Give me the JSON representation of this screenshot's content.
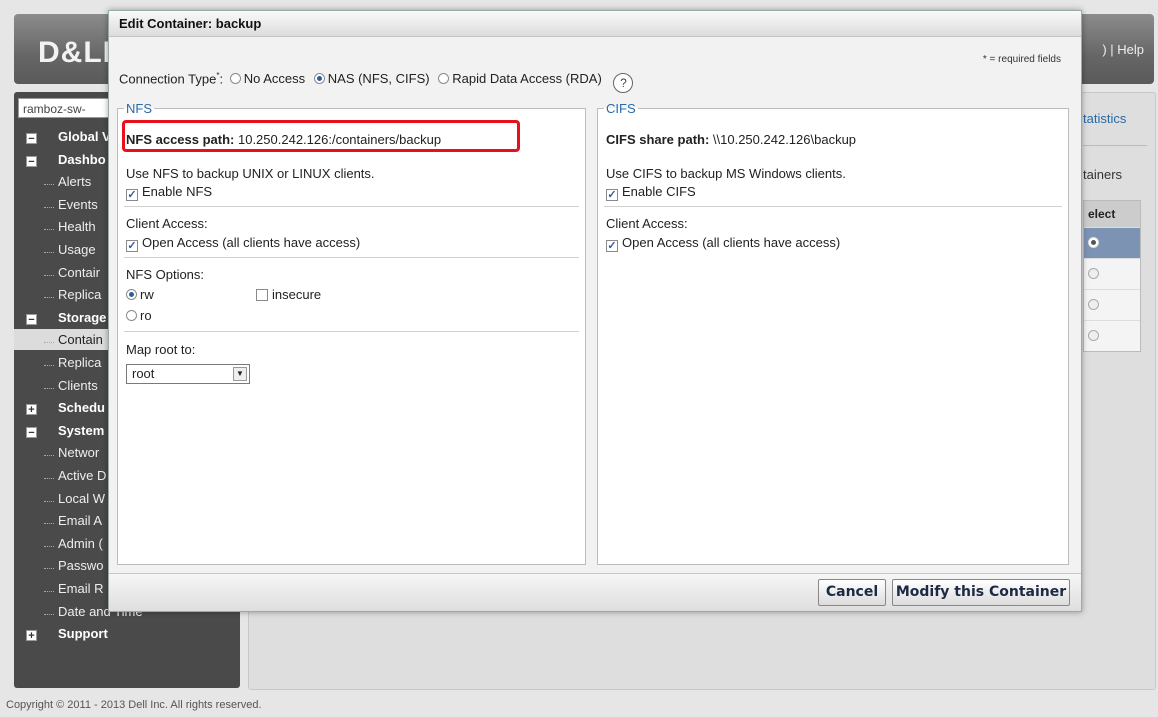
{
  "header": {
    "logo": "D&LL",
    "links": ") | Help"
  },
  "sidebar": {
    "system_select": "ramboz-sw-",
    "items": [
      {
        "label": "Global V",
        "kind": "section",
        "expander": "−"
      },
      {
        "label": "Dashbo",
        "kind": "section",
        "expander": "−"
      },
      {
        "label": "Alerts",
        "kind": "item"
      },
      {
        "label": "Events",
        "kind": "item"
      },
      {
        "label": "Health",
        "kind": "item"
      },
      {
        "label": "Usage",
        "kind": "item"
      },
      {
        "label": "Contair",
        "kind": "item"
      },
      {
        "label": "Replica",
        "kind": "item"
      },
      {
        "label": "Storage",
        "kind": "section",
        "expander": "−"
      },
      {
        "label": "Contain",
        "kind": "item",
        "selected": true
      },
      {
        "label": "Replica",
        "kind": "item"
      },
      {
        "label": "Clients",
        "kind": "item"
      },
      {
        "label": "Schedu",
        "kind": "section",
        "expander": "+"
      },
      {
        "label": "System",
        "kind": "section",
        "expander": "−"
      },
      {
        "label": "Networ",
        "kind": "item"
      },
      {
        "label": "Active D",
        "kind": "item"
      },
      {
        "label": "Local W",
        "kind": "item"
      },
      {
        "label": "Email A",
        "kind": "item"
      },
      {
        "label": "Admin (",
        "kind": "item"
      },
      {
        "label": "Passwo",
        "kind": "item"
      },
      {
        "label": "Email R",
        "kind": "item"
      },
      {
        "label": "Date and Time",
        "kind": "item"
      },
      {
        "label": "Support",
        "kind": "section",
        "expander": "+"
      }
    ]
  },
  "main": {
    "statistics_link": "tatistics",
    "containers_label": "tainers",
    "select_header": "elect"
  },
  "footer": {
    "copyright": "Copyright © 2011 - 2013 Dell Inc. All rights reserved."
  },
  "dialog": {
    "title": "Edit Container: backup",
    "required_note": "* = required fields",
    "connection_type": {
      "label": "Connection Type",
      "required_mark": "*",
      "colon": ":",
      "options": [
        "No Access",
        "NAS (NFS, CIFS)",
        "Rapid Data Access (RDA)"
      ],
      "selected": "NAS (NFS, CIFS)",
      "help_icon": "?"
    },
    "nfs": {
      "legend": "NFS",
      "access_path_label": "NFS access path:",
      "access_path_value": " 10.250.242.126:/containers/backup",
      "description": "Use NFS to backup UNIX or LINUX clients.",
      "enable_label": "Enable NFS",
      "client_access_label": "Client Access:",
      "open_access_label": "Open Access (all clients have access)",
      "options_label": "NFS Options:",
      "rw_label": "rw",
      "ro_label": "ro",
      "insecure_label": "insecure",
      "map_root_label": "Map root to:",
      "map_root_value": "root"
    },
    "cifs": {
      "legend": "CIFS",
      "share_path_label": "CIFS share path:",
      "share_path_value": " \\\\10.250.242.126\\backup",
      "description": "Use CIFS to backup MS Windows clients.",
      "enable_label": "Enable CIFS",
      "client_access_label": "Client Access:",
      "open_access_label": "Open Access (all clients have access)"
    },
    "buttons": {
      "cancel": "Cancel",
      "modify": "Modify this Container"
    }
  }
}
